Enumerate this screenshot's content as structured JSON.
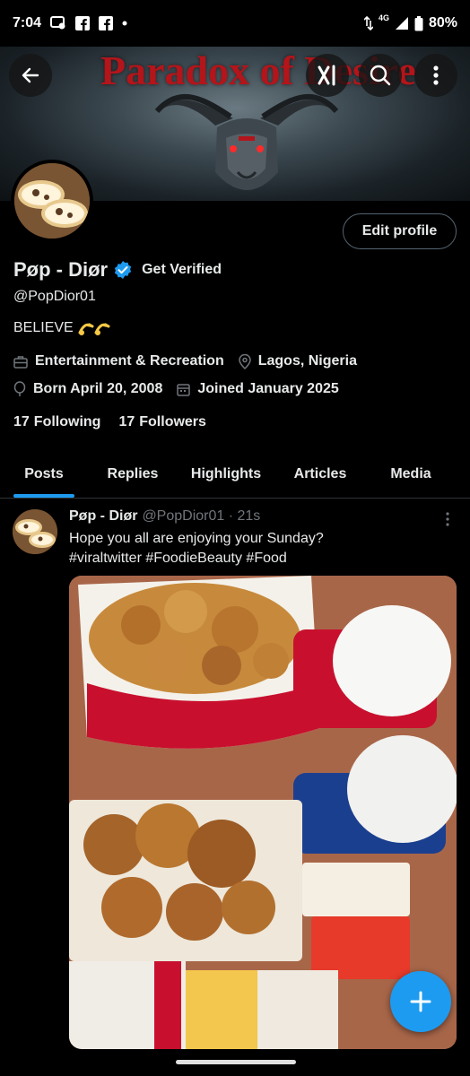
{
  "status_bar": {
    "time": "7:04",
    "network": "4G",
    "battery": "80%"
  },
  "banner": {
    "title": "Paradox of Desire",
    "badge_text": "XI"
  },
  "profile": {
    "display_name": "Pøp - Diør",
    "get_verified": "Get Verified",
    "handle": "@PopDior01",
    "bio": "BELIEVE",
    "category": "Entertainment & Recreation",
    "location": "Lagos, Nigeria",
    "born": "Born April 20, 2008",
    "joined": "Joined January 2025",
    "following_count": "17",
    "following_label": "Following",
    "followers_count": "17",
    "followers_label": "Followers",
    "edit_profile": "Edit profile"
  },
  "tabs": [
    {
      "label": "Posts",
      "active": true
    },
    {
      "label": "Replies",
      "active": false
    },
    {
      "label": "Highlights",
      "active": false
    },
    {
      "label": "Articles",
      "active": false
    },
    {
      "label": "Media",
      "active": false
    }
  ],
  "post": {
    "name": "Pøp - Diør",
    "handle_time": "@PopDior01 · 21s",
    "line1": "Hope you all are enjoying your Sunday?",
    "line2": "#viraltwitter #FoodieBeauty #Food"
  },
  "icons": {
    "back": "back-arrow-icon",
    "grok": "grok-icon",
    "search": "search-icon",
    "more": "more-vertical-icon",
    "compose": "plus-icon"
  },
  "colors": {
    "accent": "#1d9bf0",
    "background": "#000000",
    "banner_title": "#b3151a"
  }
}
